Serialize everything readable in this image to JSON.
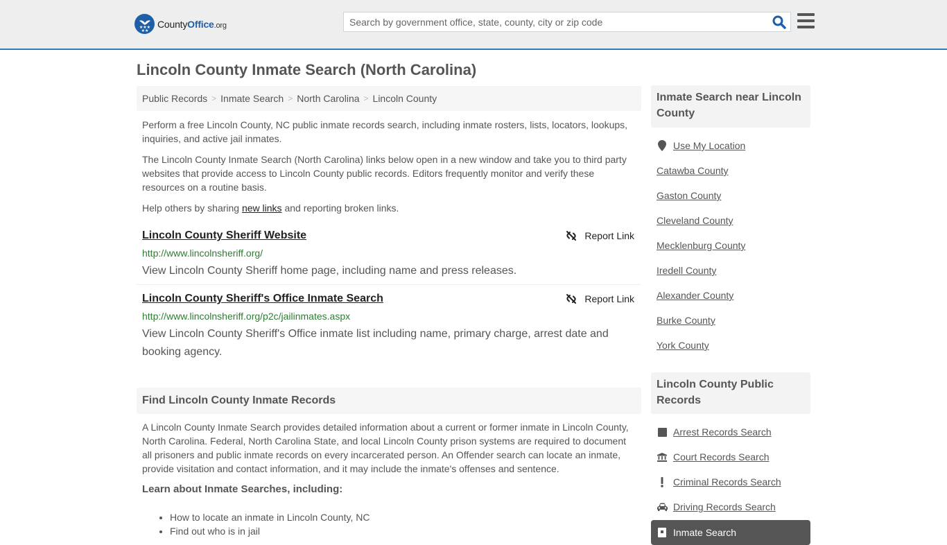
{
  "header": {
    "logo": {
      "name_prefix": "County",
      "name_accent": "Office",
      "name_suffix": ".org"
    },
    "search": {
      "placeholder": "Search by government office, state, county, city or zip code",
      "value": ""
    },
    "brand_color": "#1f5fa6",
    "accent_border": "#337ab7"
  },
  "page": {
    "title": "Lincoln County Inmate Search (North Carolina)"
  },
  "breadcrumb": [
    "Public Records",
    "Inmate Search",
    "North Carolina",
    "Lincoln County"
  ],
  "intro": {
    "p1": "Perform a free Lincoln County, NC public inmate records search, including inmate rosters, lists, locators, lookups, inquiries, and active jail inmates.",
    "p2": "The Lincoln County Inmate Search (North Carolina) links below open in a new window and take you to third party websites that provide access to Lincoln County public records. Editors frequently monitor and verify these resources on a routine basis.",
    "p3_before": "Help others by sharing ",
    "p3_link": "new links",
    "p3_after": " and reporting broken links."
  },
  "links": [
    {
      "title": "Lincoln County Sheriff Website",
      "url": "http://www.lincolnsheriff.org/",
      "description": "View Lincoln County Sheriff home page, including name and press releases.",
      "report_label": "Report Link"
    },
    {
      "title": "Lincoln County Sheriff's Office Inmate Search",
      "url": "http://www.lincolnsheriff.org/p2c/jailinmates.aspx",
      "description": "View Lincoln County Sheriff's Office inmate list including name, primary charge, arrest date and booking agency.",
      "report_label": "Report Link"
    }
  ],
  "find_section": {
    "heading": "Find Lincoln County Inmate Records",
    "body": "A Lincoln County Inmate Search provides detailed information about a current or former inmate in Lincoln County, North Carolina. Federal, North Carolina State, and local Lincoln County prison systems are required to document all prisoners and public inmate records on every incarcerated person. An Offender search can locate an inmate, provide visitation and contact information, and it may include the inmate's offenses and sentence.",
    "learn_heading": "Learn about Inmate Searches, including:",
    "bullets": [
      "How to locate an inmate in Lincoln County, NC",
      "Find out who is in jail"
    ]
  },
  "sidebar": {
    "nearby": {
      "heading": "Inmate Search near Lincoln County",
      "use_location": "Use My Location",
      "counties": [
        "Catawba County",
        "Gaston County",
        "Cleveland County",
        "Mecklenburg County",
        "Iredell County",
        "Alexander County",
        "Burke County",
        "York County"
      ]
    },
    "public_records": {
      "heading": "Lincoln County Public Records",
      "items": [
        {
          "label": "Arrest Records Search",
          "icon": "square-icon"
        },
        {
          "label": "Court Records Search",
          "icon": "courthouse-icon"
        },
        {
          "label": "Criminal Records Search",
          "icon": "exclamation-icon"
        },
        {
          "label": "Driving Records Search",
          "icon": "car-icon"
        }
      ],
      "active": {
        "label": "Inmate Search",
        "icon": "jail-door-icon"
      }
    }
  }
}
